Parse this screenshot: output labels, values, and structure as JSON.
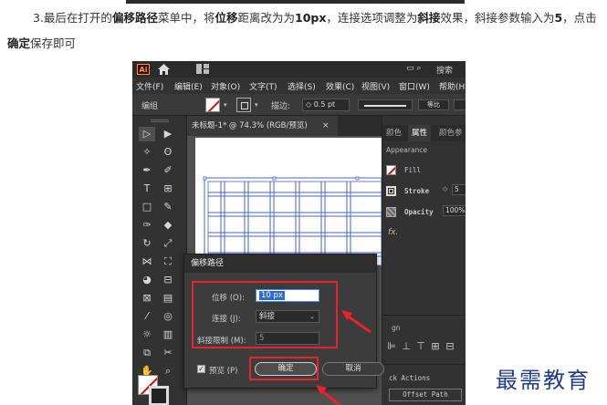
{
  "article": {
    "step_line1_parts": [
      "3.最后在打开的",
      "偏移路径",
      "菜单中，将",
      "位移",
      "距离改为为",
      "10px",
      "，连接选项调整为",
      "斜接",
      "效果，斜接参数输入为",
      "5",
      "，点击"
    ],
    "step_line2_parts": [
      "确定",
      "保存即可"
    ]
  },
  "app": {
    "logo": "Ai",
    "search_label": "搜索",
    "menu": [
      "文件(F)",
      "编辑(E)",
      "对象(O)",
      "文字(T)",
      "选择(S)",
      "效果(C)",
      "视图(V)",
      "窗口(W)",
      "帮助(H)"
    ]
  },
  "control_bar": {
    "mode_label": "编组",
    "stroke_label": "描边:",
    "stroke_value": "0.5 pt",
    "profile_label": "等比"
  },
  "document": {
    "tab_title": "未标题-1* @ 74.3% (RGB/预览)",
    "close": "×"
  },
  "right_panel": {
    "tabs": [
      "颜色",
      "属性",
      "颜色参"
    ],
    "active_tab": 1,
    "appearance_label": "Appearance",
    "fill_label": "Fill",
    "stroke_label": "Stroke",
    "stroke_value": "5",
    "opacity_label": "Opacity",
    "opacity_value": "100%",
    "fx_label": "fx.",
    "align_label": "gn",
    "pathfinder_label": "hfinder",
    "quick_actions_label": "ck Actions",
    "offset_path_button": "Offset Path"
  },
  "dialog": {
    "title": "偏移路径",
    "offset_label": "位移 (O):",
    "offset_value": "10 px",
    "joins_label": "连接 (J):",
    "joins_value": "斜接",
    "miter_label": "斜接限制 (M):",
    "miter_value": "5",
    "preview_label": "预览 (P)",
    "ok_label": "确定",
    "cancel_label": "取消"
  },
  "watermark": "最需教育",
  "colors": {
    "annotation_red": "#e8232a",
    "watermark_blue": "#1f3a93"
  }
}
